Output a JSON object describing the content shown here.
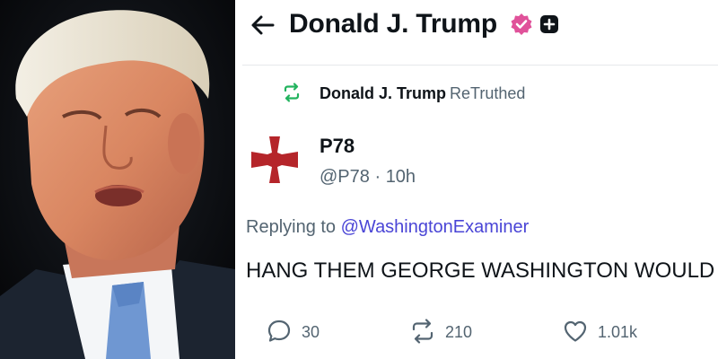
{
  "photo": {
    "alt_icon": "portrait-photo"
  },
  "header": {
    "title": "Donald J. Trump",
    "back_icon": "arrow-left-icon",
    "verified_icon": "verified-badge-icon",
    "plus_icon": "plus-badge-icon"
  },
  "retruth": {
    "name": "Donald J. Trump",
    "label": "ReTruthed",
    "icon": "retruth-icon",
    "color": "#22b35e"
  },
  "post": {
    "author_name": "P78",
    "handle": "@P78",
    "separator": "·",
    "time": "10h",
    "replying_prefix": "Replying to",
    "replying_to": "@WashingtonExaminer",
    "text": "HANG THEM GEORGE WASHINGTON WOULD"
  },
  "actions": {
    "replies": "30",
    "retruths": "210",
    "likes": "1.01k"
  },
  "colors": {
    "accent": "#4a45d6",
    "verified": "#e0529a",
    "avatar_cross": "#b5252a"
  }
}
